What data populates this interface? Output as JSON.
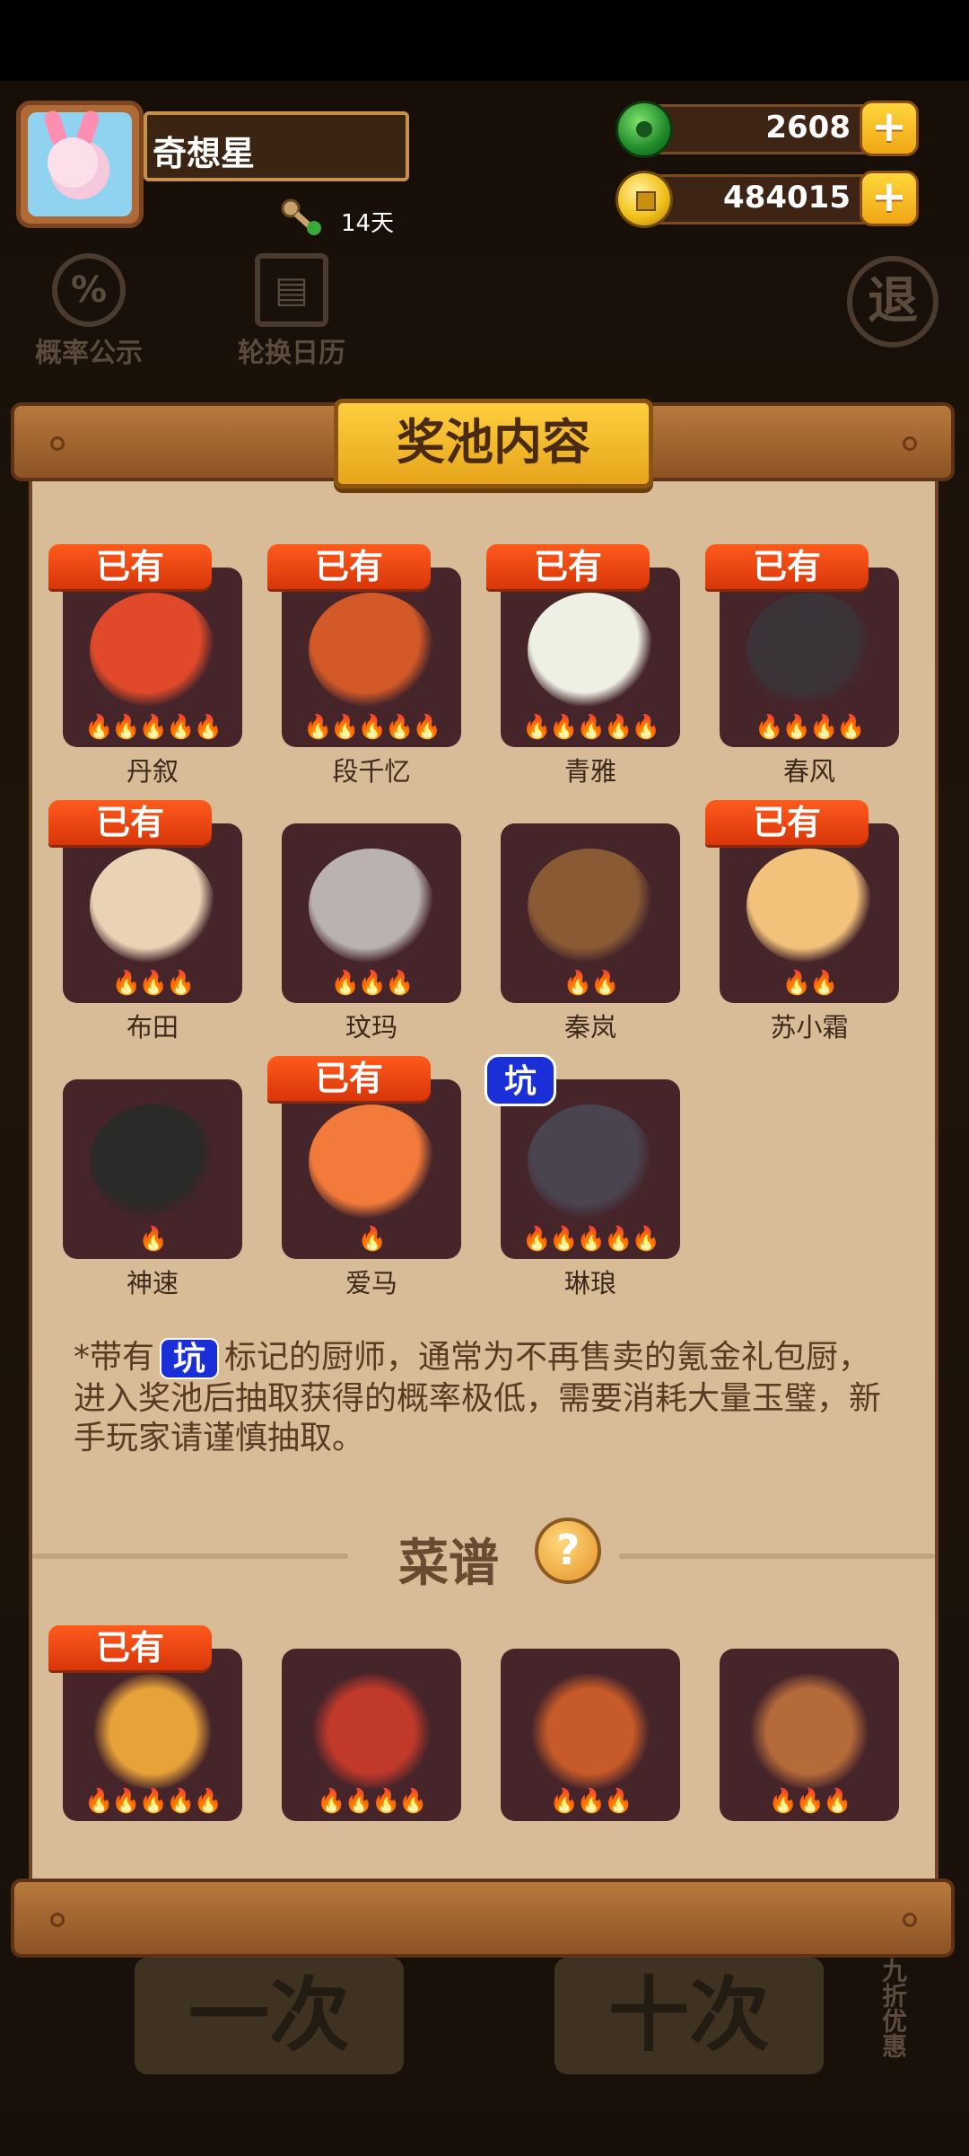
{
  "player": {
    "name": "奇想星",
    "days": "14天"
  },
  "currency": {
    "jade": "2608",
    "coins": "484015"
  },
  "background": {
    "prob_label": "概率公示",
    "calendar_label": "轮换日历",
    "exit_label": "退",
    "btn_left": "一次",
    "btn_right": "十次",
    "discount": "九折优惠"
  },
  "panel": {
    "title": "奖池内容"
  },
  "owned_tag": "已有",
  "pit_tag": "坑",
  "chefs": [
    {
      "name": "丹叙",
      "owned": true,
      "stars": "🔥🔥🔥🔥🔥",
      "color": "#e04a2a"
    },
    {
      "name": "段千忆",
      "owned": true,
      "stars": "🔥🔥🔥🔥🔥",
      "color": "#d35a28"
    },
    {
      "name": "青雅",
      "owned": true,
      "stars": "🔥🔥🔥🔥🔥",
      "color": "#eef0e4"
    },
    {
      "name": "春风",
      "owned": true,
      "stars": "🔥🔥🔥🔥",
      "color": "#3a3438"
    },
    {
      "name": "布田",
      "owned": true,
      "stars": "🔥🔥🔥",
      "color": "#e9d3b4"
    },
    {
      "name": "玟玛",
      "owned": false,
      "stars": "🔥🔥🔥",
      "color": "#b9b2ae"
    },
    {
      "name": "秦岚",
      "owned": false,
      "stars": "🔥🔥",
      "color": "#8a5a35"
    },
    {
      "name": "苏小霜",
      "owned": true,
      "stars": "🔥🔥",
      "color": "#f2c27a"
    },
    {
      "name": "神速",
      "owned": false,
      "stars": "🔥",
      "color": "#2a2a28"
    },
    {
      "name": "爱马",
      "owned": true,
      "stars": "🔥",
      "color": "#f27a3a"
    },
    {
      "name": "琳琅",
      "owned": false,
      "pit": true,
      "stars": "🔥🔥🔥🔥🔥",
      "color": "#4a4350"
    }
  ],
  "note": {
    "prefix": "*带有",
    "suffix": "标记的厨师，通常为不再售卖的氪金礼包厨，进入奖池后抽取获得的概率极低，需要消耗大量玉璧，新手玩家请谨慎抽取。"
  },
  "recipes": {
    "title": "菜谱",
    "help": "?",
    "items": [
      {
        "owned": true,
        "stars": "🔥🔥🔥🔥🔥",
        "color": "#e8a23a"
      },
      {
        "owned": false,
        "stars": "🔥🔥🔥🔥",
        "color": "#c0392b"
      },
      {
        "owned": false,
        "stars": "🔥🔥🔥",
        "color": "#c65a28"
      },
      {
        "owned": false,
        "stars": "🔥🔥🔥",
        "color": "#b56a3a"
      }
    ]
  }
}
